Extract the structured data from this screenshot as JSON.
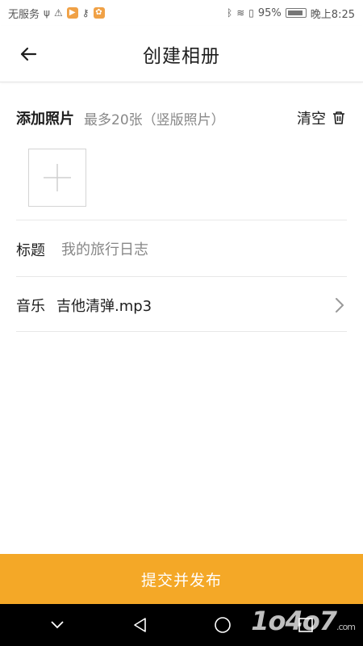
{
  "status_bar": {
    "carrier": "无服务",
    "battery": "95%",
    "time": "晚上8:25"
  },
  "header": {
    "title": "创建相册"
  },
  "photos": {
    "title": "添加照片",
    "hint": "最多20张（竖版照片）",
    "clear_label": "清空"
  },
  "form": {
    "title_label": "标题",
    "title_placeholder": "我的旅行日志",
    "music_label": "音乐",
    "music_value": "吉他清弹.mp3"
  },
  "submit": {
    "label": "提交并发布"
  },
  "watermark": {
    "text": "1o4o7",
    "suffix": ".com"
  },
  "colors": {
    "accent": "#f4a827",
    "navbar": "#000000"
  }
}
